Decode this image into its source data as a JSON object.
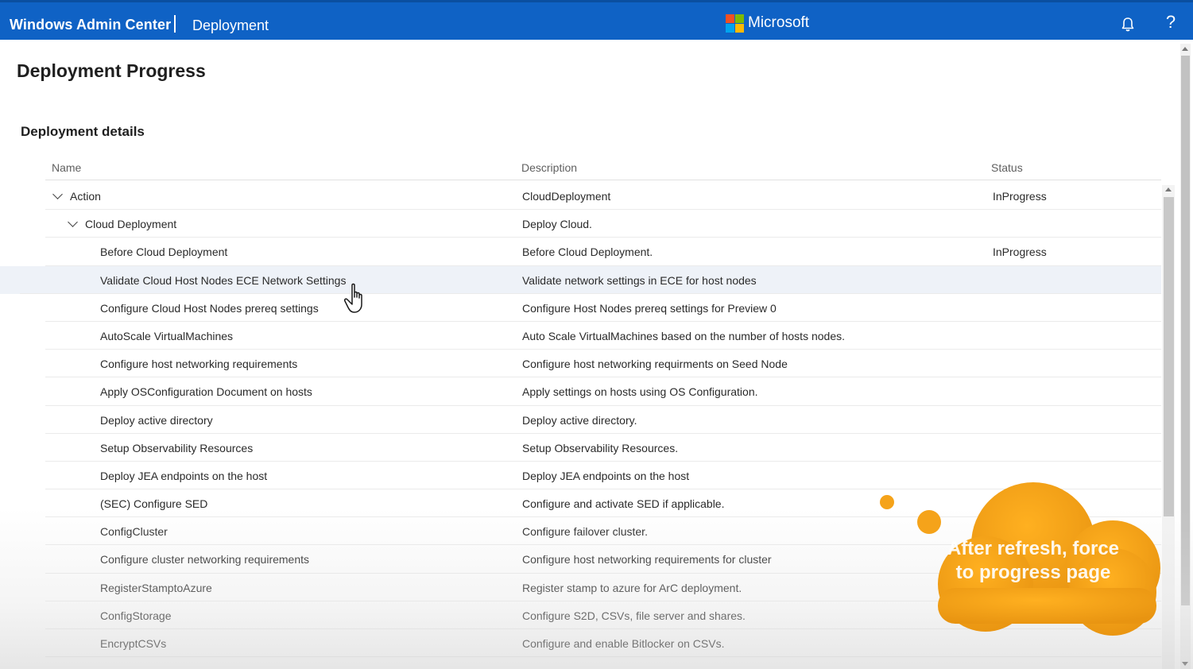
{
  "header": {
    "app_title": "Windows Admin Center",
    "breadcrumb": "Deployment",
    "brand": "Microsoft",
    "brand_colors": [
      "#f25022",
      "#7fba00",
      "#00a4ef",
      "#ffb900"
    ],
    "bar_color": "#0f62c5",
    "notifications_icon": "bell-icon",
    "help_label": "?"
  },
  "page": {
    "title": "Deployment Progress",
    "section_title": "Deployment details"
  },
  "table": {
    "columns": {
      "name": "Name",
      "description": "Description",
      "status": "Status"
    },
    "rows": [
      {
        "name": "Action",
        "description": "CloudDeployment",
        "status": "InProgress",
        "level": 0,
        "expanded": true
      },
      {
        "name": "Cloud Deployment",
        "description": "Deploy Cloud.",
        "status": "",
        "level": 1,
        "expanded": true
      },
      {
        "name": "Before Cloud Deployment",
        "description": "Before Cloud Deployment.",
        "status": "InProgress",
        "level": 2
      },
      {
        "name": "Validate Cloud Host Nodes ECE Network Settings",
        "description": "Validate network settings in ECE for host nodes",
        "status": "",
        "level": 2,
        "selected": true
      },
      {
        "name": "Configure Cloud Host Nodes prereq settings",
        "description": "Configure Host Nodes prereq settings for Preview 0",
        "status": "",
        "level": 2
      },
      {
        "name": "AutoScale VirtualMachines",
        "description": "Auto Scale VirtualMachines based on the number of hosts nodes.",
        "status": "",
        "level": 2
      },
      {
        "name": "Configure host networking requirements",
        "description": "Configure host networking requirments on Seed Node",
        "status": "",
        "level": 2
      },
      {
        "name": "Apply OSConfiguration Document on hosts",
        "description": "Apply settings on hosts using OS Configuration.",
        "status": "",
        "level": 2
      },
      {
        "name": "Deploy active directory",
        "description": "Deploy active directory.",
        "status": "",
        "level": 2
      },
      {
        "name": "Setup Observability Resources",
        "description": "Setup Observability Resources.",
        "status": "",
        "level": 2
      },
      {
        "name": "Deploy JEA endpoints on the host",
        "description": "Deploy JEA endpoints on the host",
        "status": "",
        "level": 2
      },
      {
        "name": "(SEC) Configure SED",
        "description": "Configure and activate SED if applicable.",
        "status": "",
        "level": 2
      },
      {
        "name": "ConfigCluster",
        "description": "Configure failover cluster.",
        "status": "",
        "level": 2
      },
      {
        "name": "Configure cluster networking requirements",
        "description": "Configure host networking requirements for cluster",
        "status": "",
        "level": 2
      },
      {
        "name": "RegisterStamptoAzure",
        "description": "Register stamp to azure for ArC deployment.",
        "status": "",
        "level": 2
      },
      {
        "name": "ConfigStorage",
        "description": "Configure S2D, CSVs, file server and shares.",
        "status": "",
        "level": 2
      },
      {
        "name": "EncryptCSVs",
        "description": "Configure and enable Bitlocker on CSVs.",
        "status": "",
        "level": 2
      }
    ]
  },
  "overlay": {
    "callout_text": "After refresh, force to progress page",
    "callout_color": "#f5a31a"
  }
}
